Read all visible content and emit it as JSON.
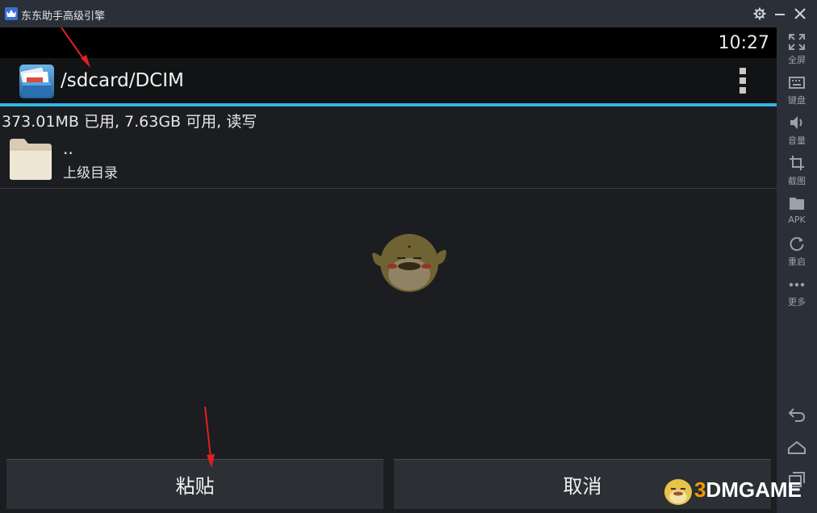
{
  "window": {
    "title": "东东助手高级引擎",
    "controls": [
      "gear-icon",
      "minimize-icon",
      "close-icon"
    ]
  },
  "toolbar": {
    "items": [
      {
        "icon": "fullscreen-icon",
        "label": "全屏"
      },
      {
        "icon": "keyboard-icon",
        "label": "键盘"
      },
      {
        "icon": "volume-icon",
        "label": "音量"
      },
      {
        "icon": "crop-icon",
        "label": "截图"
      },
      {
        "icon": "folder-icon",
        "label": "APK"
      },
      {
        "icon": "restart-icon",
        "label": "重启"
      },
      {
        "icon": "more-icon",
        "label": "更多"
      }
    ],
    "nav": [
      "back-icon",
      "home-icon",
      "recent-apps-icon"
    ]
  },
  "android": {
    "clock": "10:27",
    "path": "/sdcard/DCIM",
    "storage": "373.01MB 已用, 7.63GB 可用, 读写",
    "entries": [
      {
        "name": "..",
        "desc": "上级目录"
      }
    ],
    "buttons": {
      "paste": "粘贴",
      "cancel": "取消"
    }
  },
  "watermark": {
    "text_accent": "3",
    "text_rest": "DMGAME"
  },
  "colors": {
    "accent_line": "#33b5e5",
    "annotation_arrow": "#e0201f"
  }
}
